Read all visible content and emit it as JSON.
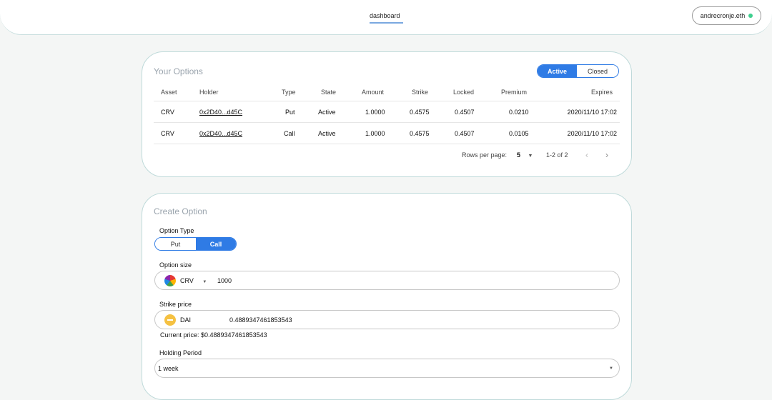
{
  "header": {
    "nav_tab": "dashboard",
    "account": "andrecronje.eth",
    "status_color": "#3ecf8e"
  },
  "options": {
    "title": "Your Options",
    "filter": {
      "active": "Active",
      "closed": "Closed",
      "selected": "Active"
    },
    "columns": [
      "Asset",
      "Holder",
      "Type",
      "State",
      "Amount",
      "Strike",
      "Locked",
      "Premium",
      "Expires"
    ],
    "rows": [
      {
        "asset": "CRV",
        "holder": "0x2D40...d45C",
        "type": "Put",
        "state": "Active",
        "amount": "1.0000",
        "strike": "0.4575",
        "locked": "0.4507",
        "premium": "0.0210",
        "expires": "2020/11/10 17:02"
      },
      {
        "asset": "CRV",
        "holder": "0x2D40...d45C",
        "type": "Call",
        "state": "Active",
        "amount": "1.0000",
        "strike": "0.4575",
        "locked": "0.4507",
        "premium": "0.0105",
        "expires": "2020/11/10 17:02"
      }
    ],
    "pagination": {
      "rows_label": "Rows per page:",
      "rows_value": "5",
      "range": "1-2 of 2"
    }
  },
  "create": {
    "title": "Create Option",
    "option_type": {
      "label": "Option Type",
      "put": "Put",
      "call": "Call",
      "selected": "Call"
    },
    "option_size": {
      "label": "Option size",
      "asset": "CRV",
      "asset_icon": "crv-token-icon",
      "value": "1000"
    },
    "strike_price": {
      "label": "Strike price",
      "asset": "DAI",
      "asset_icon": "dai-token-icon",
      "value": "0.4889347461853543",
      "current": "Current price: $0.4889347461853543"
    },
    "holding_period": {
      "label": "Holding Period",
      "value": "1 week"
    }
  },
  "colors": {
    "accent": "#2f7be5",
    "card_border": "#bfdada"
  }
}
